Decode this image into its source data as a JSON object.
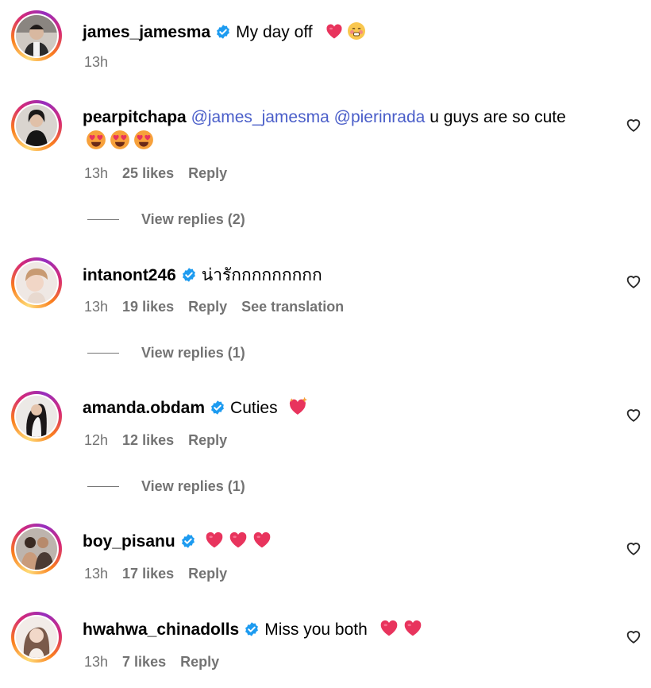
{
  "comments": [
    {
      "username": "james_jamesma",
      "verified": true,
      "text": "My day off",
      "time": "13h"
    },
    {
      "username": "pearpitchapa",
      "verified": false,
      "mention1": "@james_jamesma",
      "mention2": "@pierinrada",
      "text": "u guys are so cute",
      "time": "13h",
      "likes": "25 likes",
      "reply": "Reply",
      "view_replies": "View replies (2)"
    },
    {
      "username": "intanont246",
      "verified": true,
      "text": "น่ารักกกกกกกกก",
      "time": "13h",
      "likes": "19 likes",
      "reply": "Reply",
      "see_translation": "See translation",
      "view_replies": "View replies (1)"
    },
    {
      "username": "amanda.obdam",
      "verified": true,
      "text": "Cuties",
      "time": "12h",
      "likes": "12 likes",
      "reply": "Reply",
      "view_replies": "View replies (1)"
    },
    {
      "username": "boy_pisanu",
      "verified": true,
      "text": "",
      "time": "13h",
      "likes": "17 likes",
      "reply": "Reply"
    },
    {
      "username": "hwahwa_chinadolls",
      "verified": true,
      "text": "Miss you both",
      "time": "13h",
      "likes": "7 likes",
      "reply": "Reply"
    }
  ],
  "icons": {
    "verified": "verified-badge-icon",
    "like": "heart-outline-icon",
    "emoji_heart": "red-heart-emoji",
    "emoji_heart_eyes": "heart-eyes-emoji",
    "emoji_blush": "blushing-face-emoji",
    "emoji_sparkle_heart": "sparkling-heart-emoji"
  },
  "colors": {
    "verified": "#1d9bf0",
    "mention": "#4a5ec9",
    "muted": "#737373",
    "heart_emoji": "#e8345d"
  }
}
